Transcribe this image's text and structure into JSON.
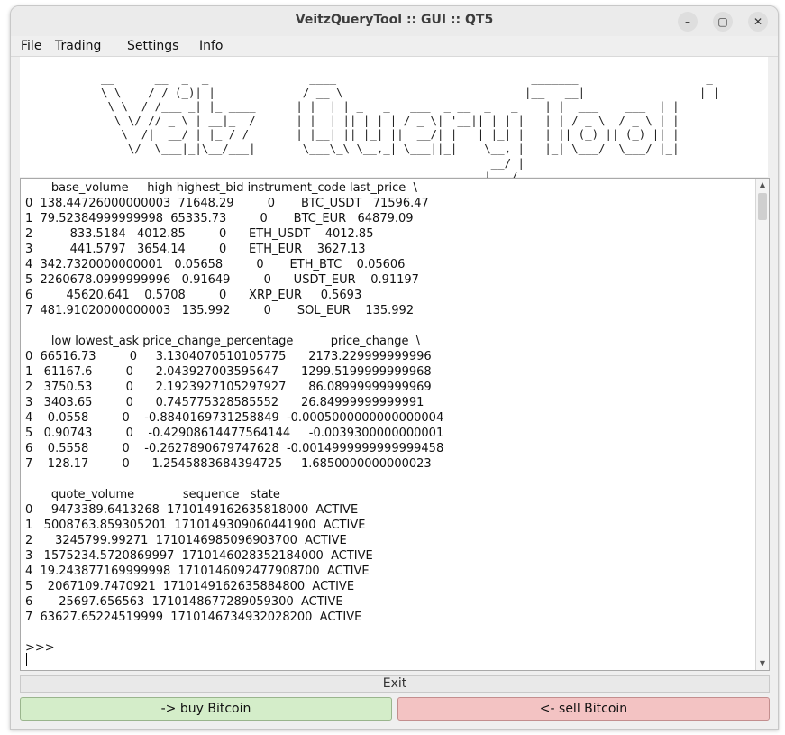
{
  "window": {
    "title": "VeitzQueryTool :: GUI :: QT5"
  },
  "window_controls": {
    "minimize": "–",
    "maximize": "▢",
    "close": "✕"
  },
  "menu": {
    "items": [
      "File",
      "Trading",
      "Settings",
      "Info"
    ]
  },
  "logo": {
    "ascii": "__      __  _  _               ____                             _______                   _\n\\ \\    / / (_)| |             / __ \\                           |__   __|                 | |\n \\ \\  / /___ _| |_ ____      | |  | | _   _   ___  _ __  _   _    | |  ___    ___  | |\n  \\ \\/ // _ \\ | __|_  /      | |  | || | | | / _ \\| '__|| | | |   | | / _ \\  / _ \\ | |\n   \\  /|  __/ | |_ / /       | |__| || |_| ||  __/| |   | |_| |   | || (_) || (_) || |\n    \\/  \\___|_|\\__/___|       \\___\\_\\ \\__,_| \\___||_|    \\__, |   |_| \\___/  \\___/ |_|\n                                                          __/ |\n                                                         |___/"
  },
  "console": {
    "output": "       base_volume     high highest_bid instrument_code last_price  \\\n0  138.44726000000003  71648.29         0       BTC_USDT   71596.47\n1  79.52384999999998  65335.73         0       BTC_EUR   64879.09\n2          833.5184   4012.85         0      ETH_USDT    4012.85\n3          441.5797   3654.14         0      ETH_EUR    3627.13\n4  342.7320000000001   0.05658         0       ETH_BTC    0.05606\n5  2260678.0999999996   0.91649         0      USDT_EUR    0.91197\n6         45620.641    0.5708         0      XRP_EUR     0.5693\n7  481.91020000000003   135.992         0       SOL_EUR    135.992\n\n       low lowest_ask price_change_percentage          price_change  \\\n0  66516.73         0     3.1304070510105775      2173.229999999996\n1   61167.6         0      2.043927003595647      1299.5199999999968\n2   3750.53         0      2.1923927105297927      86.08999999999969\n3   3403.65         0      0.745775328585552      26.84999999999991\n4    0.0558         0    -0.8840169731258849  -0.0005000000000000004\n5   0.90743         0    -0.42908614477564144     -0.0039300000000001\n6    0.5558         0    -0.2627890679747628  -0.0014999999999999458\n7    128.17         0      1.2545883684394725     1.6850000000000023\n\n       quote_volume             sequence   state\n0     9473389.6413268  1710149162635818000  ACTIVE\n1   5008763.859305201  1710149309060441900  ACTIVE\n2      3245799.99271  1710146985096903700  ACTIVE\n3   1575234.5720869997  1710146028352184000  ACTIVE\n4  19.243877169999998  1710146092477908700  ACTIVE\n5    2067109.7470921  1710149162635884800  ACTIVE\n6       25697.656563  1710148677289059300  ACTIVE\n7  63627.65224519999  1710146734932028200  ACTIVE\n\n>>>"
  },
  "buttons": {
    "exit": "Exit",
    "buy": "-> buy Bitcoin",
    "sell": "<- sell Bitcoin"
  },
  "colors": {
    "buy": "#d4edc9",
    "sell": "#f3c3c3",
    "titlebar": "#ebebeb"
  }
}
